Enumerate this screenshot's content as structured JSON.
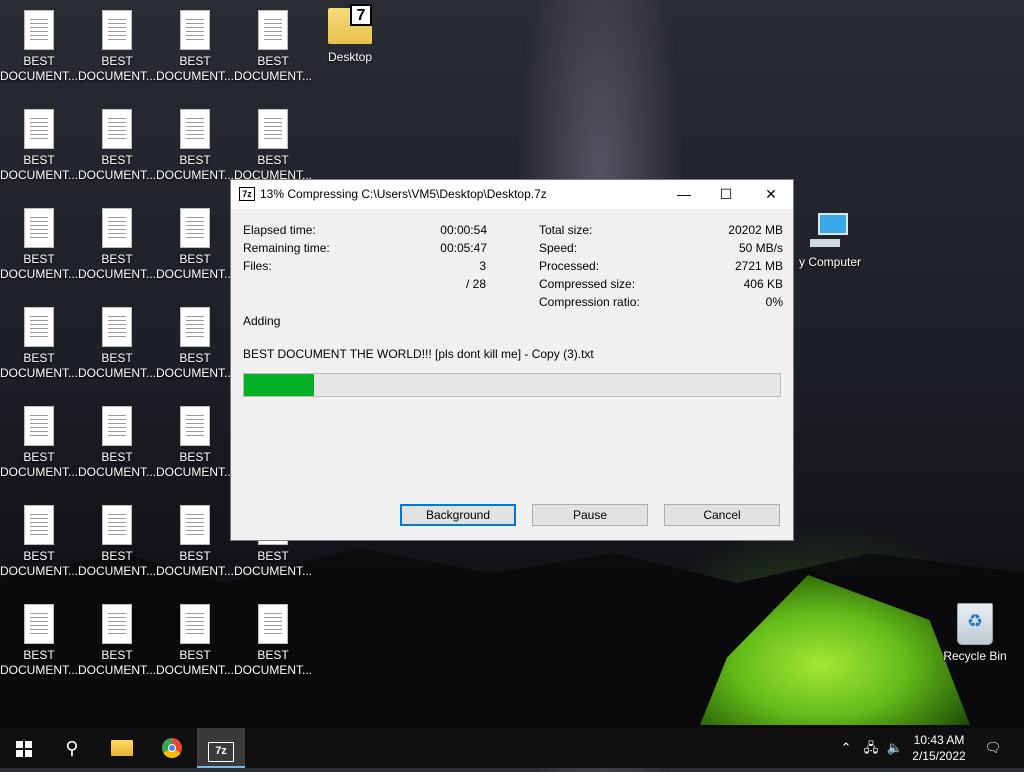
{
  "desktop": {
    "doc_label_line1": "BEST",
    "doc_label_line2": "DOCUMENT...",
    "folder_label": "Desktop",
    "pc_label": "y Computer",
    "recycle_label": "Recycle Bin"
  },
  "dialog": {
    "app_icon": "7z",
    "title": "13% Compressing C:\\Users\\VM5\\Desktop\\Desktop.7z",
    "minimize": "—",
    "maximize": "☐",
    "close": "✕",
    "stats_left": [
      {
        "label": "Elapsed time:",
        "value": "00:00:54"
      },
      {
        "label": "Remaining time:",
        "value": "00:05:47"
      },
      {
        "label": "Files:",
        "value": "3"
      },
      {
        "label": "",
        "value": "/ 28"
      }
    ],
    "stats_right": [
      {
        "label": "Total size:",
        "value": "20202 MB"
      },
      {
        "label": "Speed:",
        "value": "50 MB/s"
      },
      {
        "label": "Processed:",
        "value": "2721 MB"
      },
      {
        "label": "Compressed size:",
        "value": "406 KB"
      },
      {
        "label": "Compression ratio:",
        "value": "0%"
      }
    ],
    "status": "Adding",
    "current_file": "BEST DOCUMENT THE WORLD!!! [pls dont kill me] - Copy (3).txt",
    "progress_percent": 13,
    "buttons": {
      "background": "Background",
      "pause": "Pause",
      "cancel": "Cancel"
    }
  },
  "taskbar": {
    "sz_label": "7z",
    "clock_time": "10:43 AM",
    "clock_date": "2/15/2022"
  },
  "colors": {
    "progress": "#06b025",
    "taskbar": "#101010",
    "accent": "#0078d7"
  }
}
